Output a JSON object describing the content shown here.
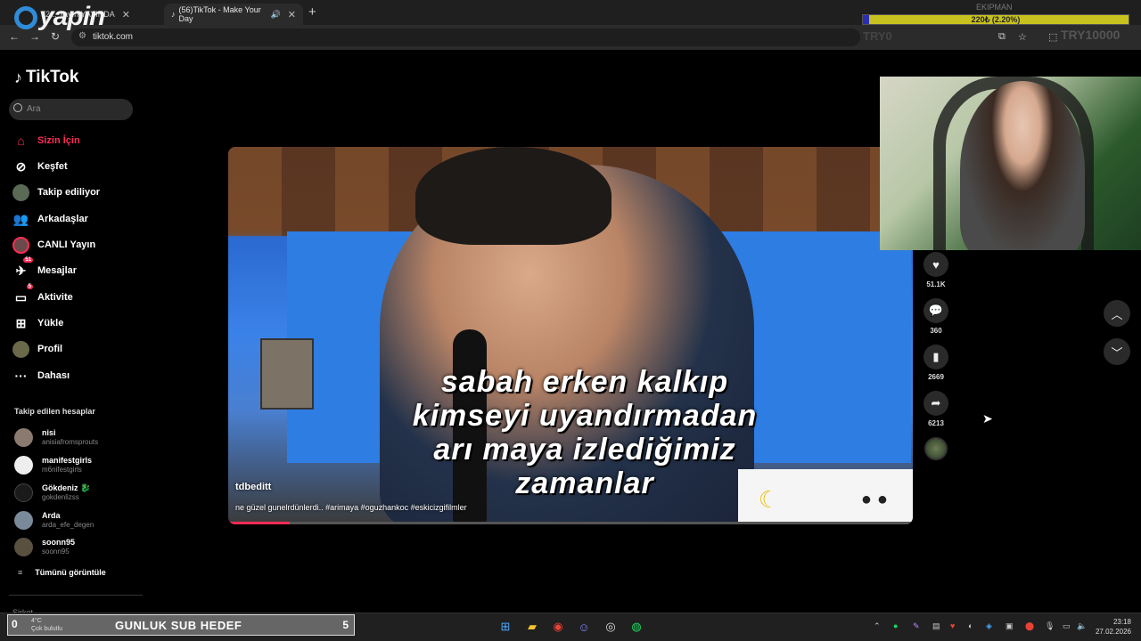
{
  "browser": {
    "tabs": [
      {
        "title": "(2... Yayın YAYINDA",
        "active": false
      },
      {
        "title": "(56)TikTok - Make Your Day",
        "active": true
      }
    ],
    "url": "tiktok.com"
  },
  "overlay": {
    "brand": "yapin",
    "ekipman": "EKIPMAN",
    "progress_text": "220₺ (2.20%)",
    "progress_fraction": 0.022,
    "min_label": "TRY0",
    "max_label": "TRY10000"
  },
  "sidebar": {
    "logo": "TikTok",
    "search_placeholder": "Ara",
    "nav": [
      {
        "label": "Sizin İçin",
        "icon": "home-icon",
        "active": true
      },
      {
        "label": "Keşfet",
        "icon": "compass-icon"
      },
      {
        "label": "Takip ediliyor",
        "icon": "avatar"
      },
      {
        "label": "Arkadaşlar",
        "icon": "friends-icon"
      },
      {
        "label": "CANLI Yayın",
        "icon": "live-avatar"
      },
      {
        "label": "Mesajlar",
        "icon": "paper-plane-icon",
        "badge": "51"
      },
      {
        "label": "Aktivite",
        "icon": "activity-icon",
        "badge": "5"
      },
      {
        "label": "Yükle",
        "icon": "upload-icon"
      },
      {
        "label": "Profil",
        "icon": "avatar"
      },
      {
        "label": "Dahası",
        "icon": "more-icon"
      }
    ],
    "following_title": "Takip edilen hesaplar",
    "accounts": [
      {
        "name": "nisi",
        "handle": "anisiafromsprouts"
      },
      {
        "name": "manifestgirls",
        "handle": "m6nifestgirls"
      },
      {
        "name": "Gökdeniz 🐉",
        "handle": "gokdenlizss"
      },
      {
        "name": "Arda",
        "handle": "arda_efe_degen"
      },
      {
        "name": "soonn95",
        "handle": "soonn95"
      }
    ],
    "see_all": "Tümünü görüntüle",
    "footer": "Şirket"
  },
  "video": {
    "subtitle_lines": [
      "sabah erken kalkıp",
      "kimseyi uyandırmadan",
      "arı maya izlediğimiz",
      "zamanlar"
    ],
    "author": "tdbeditt",
    "caption": "ne güzel gunelrdünlerdi.. #arimaya #oguzhankoc #eskicizgifilmler",
    "progress_fraction": 0.09
  },
  "actions": {
    "likes": "51.1K",
    "comments": "360",
    "saves": "2669",
    "shares": "6213"
  },
  "taskbar": {
    "weather_temp": "4°C",
    "weather_desc": "Çok bulutlu",
    "sub_goal_count": "0",
    "sub_goal_label": "GUNLUK SUB HEDEF",
    "sub_goal_target": "5",
    "time": "23:18",
    "date": "27.02.2026"
  }
}
